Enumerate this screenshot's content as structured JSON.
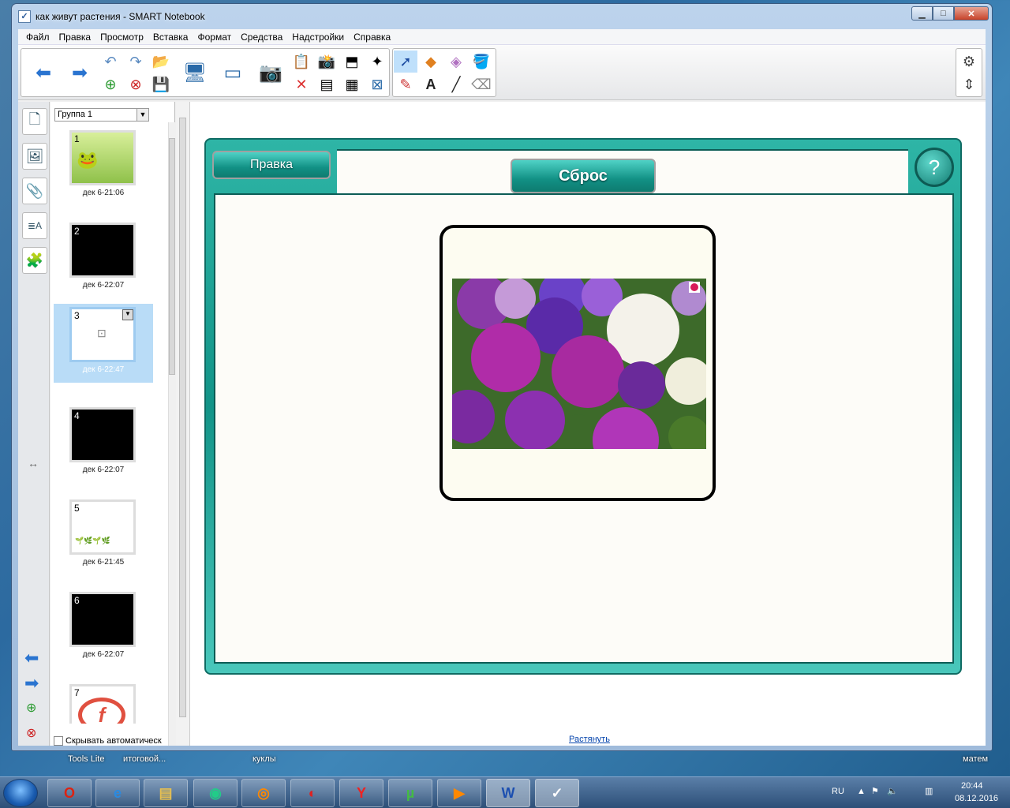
{
  "window": {
    "title": "как живут растения - SMART Notebook",
    "icon": "notebook-icon"
  },
  "menu": [
    "Файл",
    "Правка",
    "Просмотр",
    "Вставка",
    "Формат",
    "Средства",
    "Надстройки",
    "Справка"
  ],
  "sorter": {
    "group": "Группа 1",
    "pages": [
      {
        "num": "1",
        "time": "дек 6-21:06",
        "style": "green"
      },
      {
        "num": "2",
        "time": "дек 6-22:07",
        "style": "black"
      },
      {
        "num": "3",
        "time": "дек 6-22:47",
        "style": "selected"
      },
      {
        "num": "4",
        "time": "дек 6-22:07",
        "style": "black"
      },
      {
        "num": "5",
        "time": "дек 6-21:45",
        "style": "white"
      },
      {
        "num": "6",
        "time": "дек 6-22:07",
        "style": "black"
      },
      {
        "num": "7",
        "time": "",
        "style": "logo"
      }
    ],
    "auto_hide": "Скрывать автоматическ"
  },
  "canvas": {
    "edit_button": "Правка",
    "reset_button": "Сброс",
    "help_button": "?",
    "stretch_link": "Растянуть"
  },
  "desktop": {
    "labels": [
      "Tools Lite",
      "итоговой...",
      "куклы",
      "матем"
    ]
  },
  "taskbar": {
    "apps": [
      "opera",
      "ie",
      "explorer",
      "chrome",
      "firefox",
      "screen-rec",
      "yandex",
      "utorrent",
      "media",
      "word",
      "notebook"
    ],
    "lang": "RU",
    "time": "20:44",
    "date": "08.12.2016"
  },
  "colors": {
    "frame": "#1a9c90",
    "selected": "#b9dcf7"
  }
}
